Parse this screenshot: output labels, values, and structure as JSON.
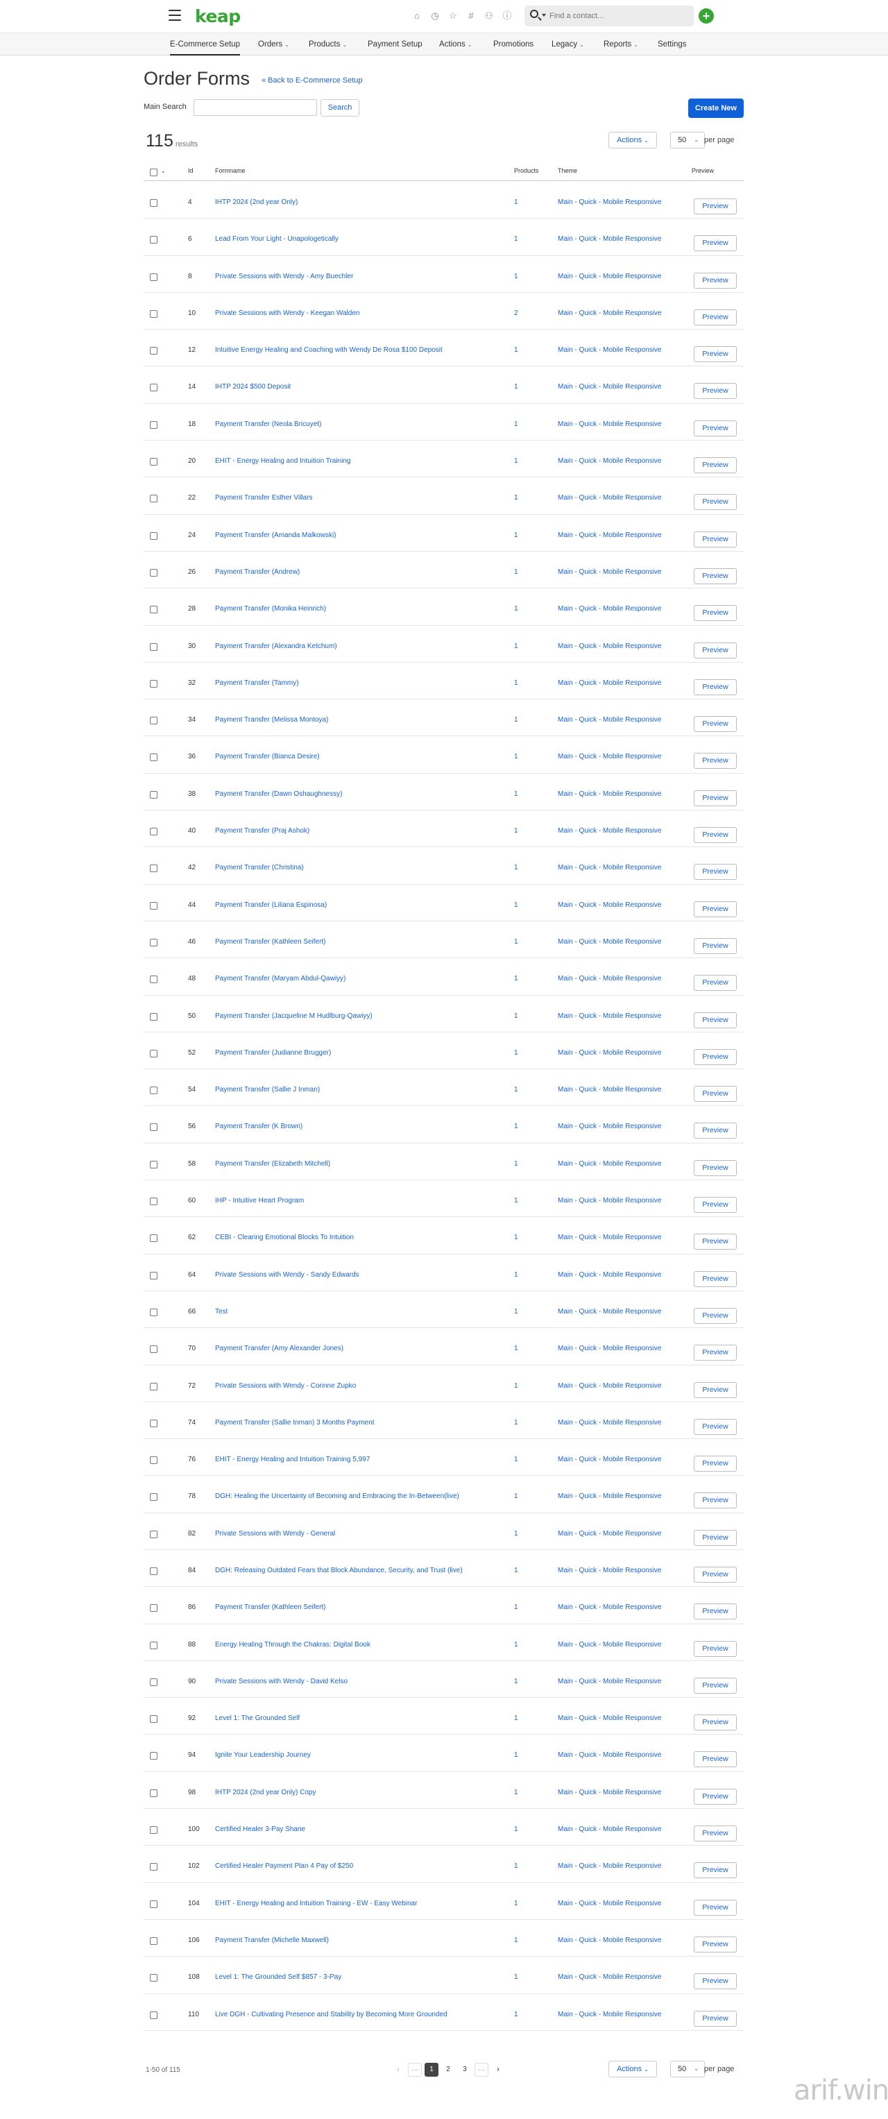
{
  "header": {
    "logo": "keap",
    "search_placeholder": "Find a contact...",
    "icons": [
      "home-icon",
      "clock-icon",
      "star-icon",
      "hash-icon",
      "person-icon",
      "help-icon"
    ]
  },
  "nav": [
    {
      "label": "E-Commerce Setup",
      "dropdown": false,
      "active": true
    },
    {
      "label": "Orders",
      "dropdown": true
    },
    {
      "label": "Products",
      "dropdown": true
    },
    {
      "label": "Payment Setup",
      "dropdown": false
    },
    {
      "label": "Actions",
      "dropdown": true
    },
    {
      "label": "Promotions",
      "dropdown": false
    },
    {
      "label": "Legacy",
      "dropdown": true
    },
    {
      "label": "Reports",
      "dropdown": true
    },
    {
      "label": "Settings",
      "dropdown": false
    }
  ],
  "page": {
    "title": "Order Forms",
    "back_link": "« Back to E-Commerce Setup",
    "search_label": "Main Search",
    "search_button": "Search",
    "create_button": "Create New",
    "result_count": "115",
    "results_label": "results",
    "actions_label": "Actions",
    "per_page_value": "50",
    "per_page_label": "per page"
  },
  "table": {
    "columns": {
      "id": "Id",
      "formname": "Formname",
      "products": "Products",
      "theme": "Theme",
      "preview": "Preview"
    },
    "rows": [
      {
        "id": "4",
        "name": "IHTP 2024 (2nd year Only)",
        "products": "1",
        "theme": "Main - Quick - Mobile Responsive"
      },
      {
        "id": "6",
        "name": "Lead From Your Light - Unapologetically",
        "products": "1",
        "theme": "Main - Quick - Mobile Responsive"
      },
      {
        "id": "8",
        "name": "Private Sessions with Wendy - Amy Buechler",
        "products": "1",
        "theme": "Main - Quick - Mobile Responsive"
      },
      {
        "id": "10",
        "name": "Private Sessions with Wendy - Keegan Walden",
        "products": "2",
        "theme": "Main - Quick - Mobile Responsive"
      },
      {
        "id": "12",
        "name": "Intuitive Energy Healing and Coaching with Wendy De Rosa $100 Deposit",
        "products": "1",
        "theme": "Main - Quick - Mobile Responsive"
      },
      {
        "id": "14",
        "name": "IHTP 2024 $500 Deposit",
        "products": "1",
        "theme": "Main - Quick - Mobile Responsive"
      },
      {
        "id": "18",
        "name": "Payment Transfer (Neola Bricuyet)",
        "products": "1",
        "theme": "Main - Quick - Mobile Responsive"
      },
      {
        "id": "20",
        "name": "EHIT - Energy Healing and Intuition Training",
        "products": "1",
        "theme": "Main - Quick - Mobile Responsive"
      },
      {
        "id": "22",
        "name": "Payment Transfer Esther Villars",
        "products": "1",
        "theme": "Main - Quick - Mobile Responsive"
      },
      {
        "id": "24",
        "name": "Payment Transfer (Amanda Malkowski)",
        "products": "1",
        "theme": "Main - Quick - Mobile Responsive"
      },
      {
        "id": "26",
        "name": "Payment Transfer (Andrew)",
        "products": "1",
        "theme": "Main - Quick - Mobile Responsive"
      },
      {
        "id": "28",
        "name": "Payment Transfer (Monika Heinrich)",
        "products": "1",
        "theme": "Main - Quick - Mobile Responsive"
      },
      {
        "id": "30",
        "name": "Payment Transfer (Alexandra Ketchum)",
        "products": "1",
        "theme": "Main - Quick - Mobile Responsive"
      },
      {
        "id": "32",
        "name": "Payment Transfer (Tammy)",
        "products": "1",
        "theme": "Main - Quick - Mobile Responsive"
      },
      {
        "id": "34",
        "name": "Payment Transfer (Melissa Montoya)",
        "products": "1",
        "theme": "Main - Quick - Mobile Responsive"
      },
      {
        "id": "36",
        "name": "Payment Transfer (Bianca Desire)",
        "products": "1",
        "theme": "Main - Quick - Mobile Responsive"
      },
      {
        "id": "38",
        "name": "Payment Transfer (Dawn Oshaughnessy)",
        "products": "1",
        "theme": "Main - Quick - Mobile Responsive"
      },
      {
        "id": "40",
        "name": "Payment Transfer (Praj Ashok)",
        "products": "1",
        "theme": "Main - Quick - Mobile Responsive"
      },
      {
        "id": "42",
        "name": "Payment Transfer (Christina)",
        "products": "1",
        "theme": "Main - Quick - Mobile Responsive"
      },
      {
        "id": "44",
        "name": "Payment Transfer (Liliana Espinosa)",
        "products": "1",
        "theme": "Main - Quick - Mobile Responsive"
      },
      {
        "id": "46",
        "name": "Payment Transfer (Kathleen Seifert)",
        "products": "1",
        "theme": "Main - Quick - Mobile Responsive"
      },
      {
        "id": "48",
        "name": "Payment Transfer (Maryam Abdul-Qawiyy)",
        "products": "1",
        "theme": "Main - Quick - Mobile Responsive"
      },
      {
        "id": "50",
        "name": "Payment Transfer (Jacqueline M Hudlburg-Qawiyy)",
        "products": "1",
        "theme": "Main - Quick - Mobile Responsive"
      },
      {
        "id": "52",
        "name": "Payment Transfer (Judianne Brugger)",
        "products": "1",
        "theme": "Main - Quick - Mobile Responsive"
      },
      {
        "id": "54",
        "name": "Payment Transfer (Sallie J Inman)",
        "products": "1",
        "theme": "Main - Quick - Mobile Responsive"
      },
      {
        "id": "56",
        "name": "Payment Transfer (K Brown)",
        "products": "1",
        "theme": "Main - Quick - Mobile Responsive"
      },
      {
        "id": "58",
        "name": "Payment Transfer (Elizabeth Mitchell)",
        "products": "1",
        "theme": "Main - Quick - Mobile Responsive"
      },
      {
        "id": "60",
        "name": "IHP - Intuitive Heart Program",
        "products": "1",
        "theme": "Main - Quick - Mobile Responsive"
      },
      {
        "id": "62",
        "name": "CEBI - Clearing Emotional Blocks To Intuition",
        "products": "1",
        "theme": "Main - Quick - Mobile Responsive"
      },
      {
        "id": "64",
        "name": "Private Sessions with Wendy - Sandy Edwards",
        "products": "1",
        "theme": "Main - Quick - Mobile Responsive"
      },
      {
        "id": "66",
        "name": "Test",
        "products": "1",
        "theme": "Main - Quick - Mobile Responsive"
      },
      {
        "id": "70",
        "name": "Payment Transfer (Amy Alexander Jones)",
        "products": "1",
        "theme": "Main - Quick - Mobile Responsive"
      },
      {
        "id": "72",
        "name": "Private Sessions with Wendy - Corinne Zupko",
        "products": "1",
        "theme": "Main - Quick - Mobile Responsive"
      },
      {
        "id": "74",
        "name": "Payment Transfer (Sallie Inman) 3 Months Payment",
        "products": "1",
        "theme": "Main - Quick - Mobile Responsive"
      },
      {
        "id": "76",
        "name": "EHIT - Energy Healing and Intuition Training 5,997",
        "products": "1",
        "theme": "Main - Quick - Mobile Responsive"
      },
      {
        "id": "78",
        "name": "DGH: Healing the Uncertainty of Becoming and Embracing the In-Between(live)",
        "products": "1",
        "theme": "Main - Quick - Mobile Responsive"
      },
      {
        "id": "82",
        "name": "Private Sessions with Wendy - General",
        "products": "1",
        "theme": "Main - Quick - Mobile Responsive"
      },
      {
        "id": "84",
        "name": "DGH: Releasing Outdated Fears that Block Abundance, Security, and Trust (live)",
        "products": "1",
        "theme": "Main - Quick - Mobile Responsive"
      },
      {
        "id": "86",
        "name": "Payment Transfer (Kathleen Seifert)",
        "products": "1",
        "theme": "Main - Quick - Mobile Responsive"
      },
      {
        "id": "88",
        "name": "Energy Healing Through the Chakras: Digital Book",
        "products": "1",
        "theme": "Main - Quick - Mobile Responsive"
      },
      {
        "id": "90",
        "name": "Private Sessions with Wendy - David Kelso",
        "products": "1",
        "theme": "Main - Quick - Mobile Responsive"
      },
      {
        "id": "92",
        "name": "Level 1: The Grounded Self",
        "products": "1",
        "theme": "Main - Quick - Mobile Responsive"
      },
      {
        "id": "94",
        "name": "Ignite Your Leadership Journey",
        "products": "1",
        "theme": "Main - Quick - Mobile Responsive"
      },
      {
        "id": "98",
        "name": "IHTP 2024 (2nd year Only) Copy",
        "products": "1",
        "theme": "Main - Quick - Mobile Responsive"
      },
      {
        "id": "100",
        "name": "Certified Healer 3-Pay Shane",
        "products": "1",
        "theme": "Main - Quick - Mobile Responsive"
      },
      {
        "id": "102",
        "name": "Certified Healer Payment Plan 4 Pay of $250",
        "products": "1",
        "theme": "Main - Quick - Mobile Responsive"
      },
      {
        "id": "104",
        "name": "EHIT - Energy Healing and Intuition Training - EW - Easy Webinar",
        "products": "1",
        "theme": "Main - Quick - Mobile Responsive"
      },
      {
        "id": "106",
        "name": "Payment Transfer (Michelle Maxwell)",
        "products": "1",
        "theme": "Main - Quick - Mobile Responsive"
      },
      {
        "id": "108",
        "name": "Level 1: The Grounded Self $857 - 3-Pay",
        "products": "1",
        "theme": "Main - Quick - Mobile Responsive"
      },
      {
        "id": "110",
        "name": "Live DGH - Cultivating Presence and Stability by Becoming More Grounded",
        "products": "1",
        "theme": "Main - Quick - Mobile Responsive"
      }
    ],
    "preview_label": "Preview"
  },
  "footer": {
    "range": "1-50 of 115",
    "pages": [
      "1",
      "2",
      "3"
    ],
    "current_page": "1",
    "ellipsis": "···",
    "prev": "‹",
    "next": "›"
  },
  "watermark": {
    "text": "arif.win",
    "k": "k"
  }
}
